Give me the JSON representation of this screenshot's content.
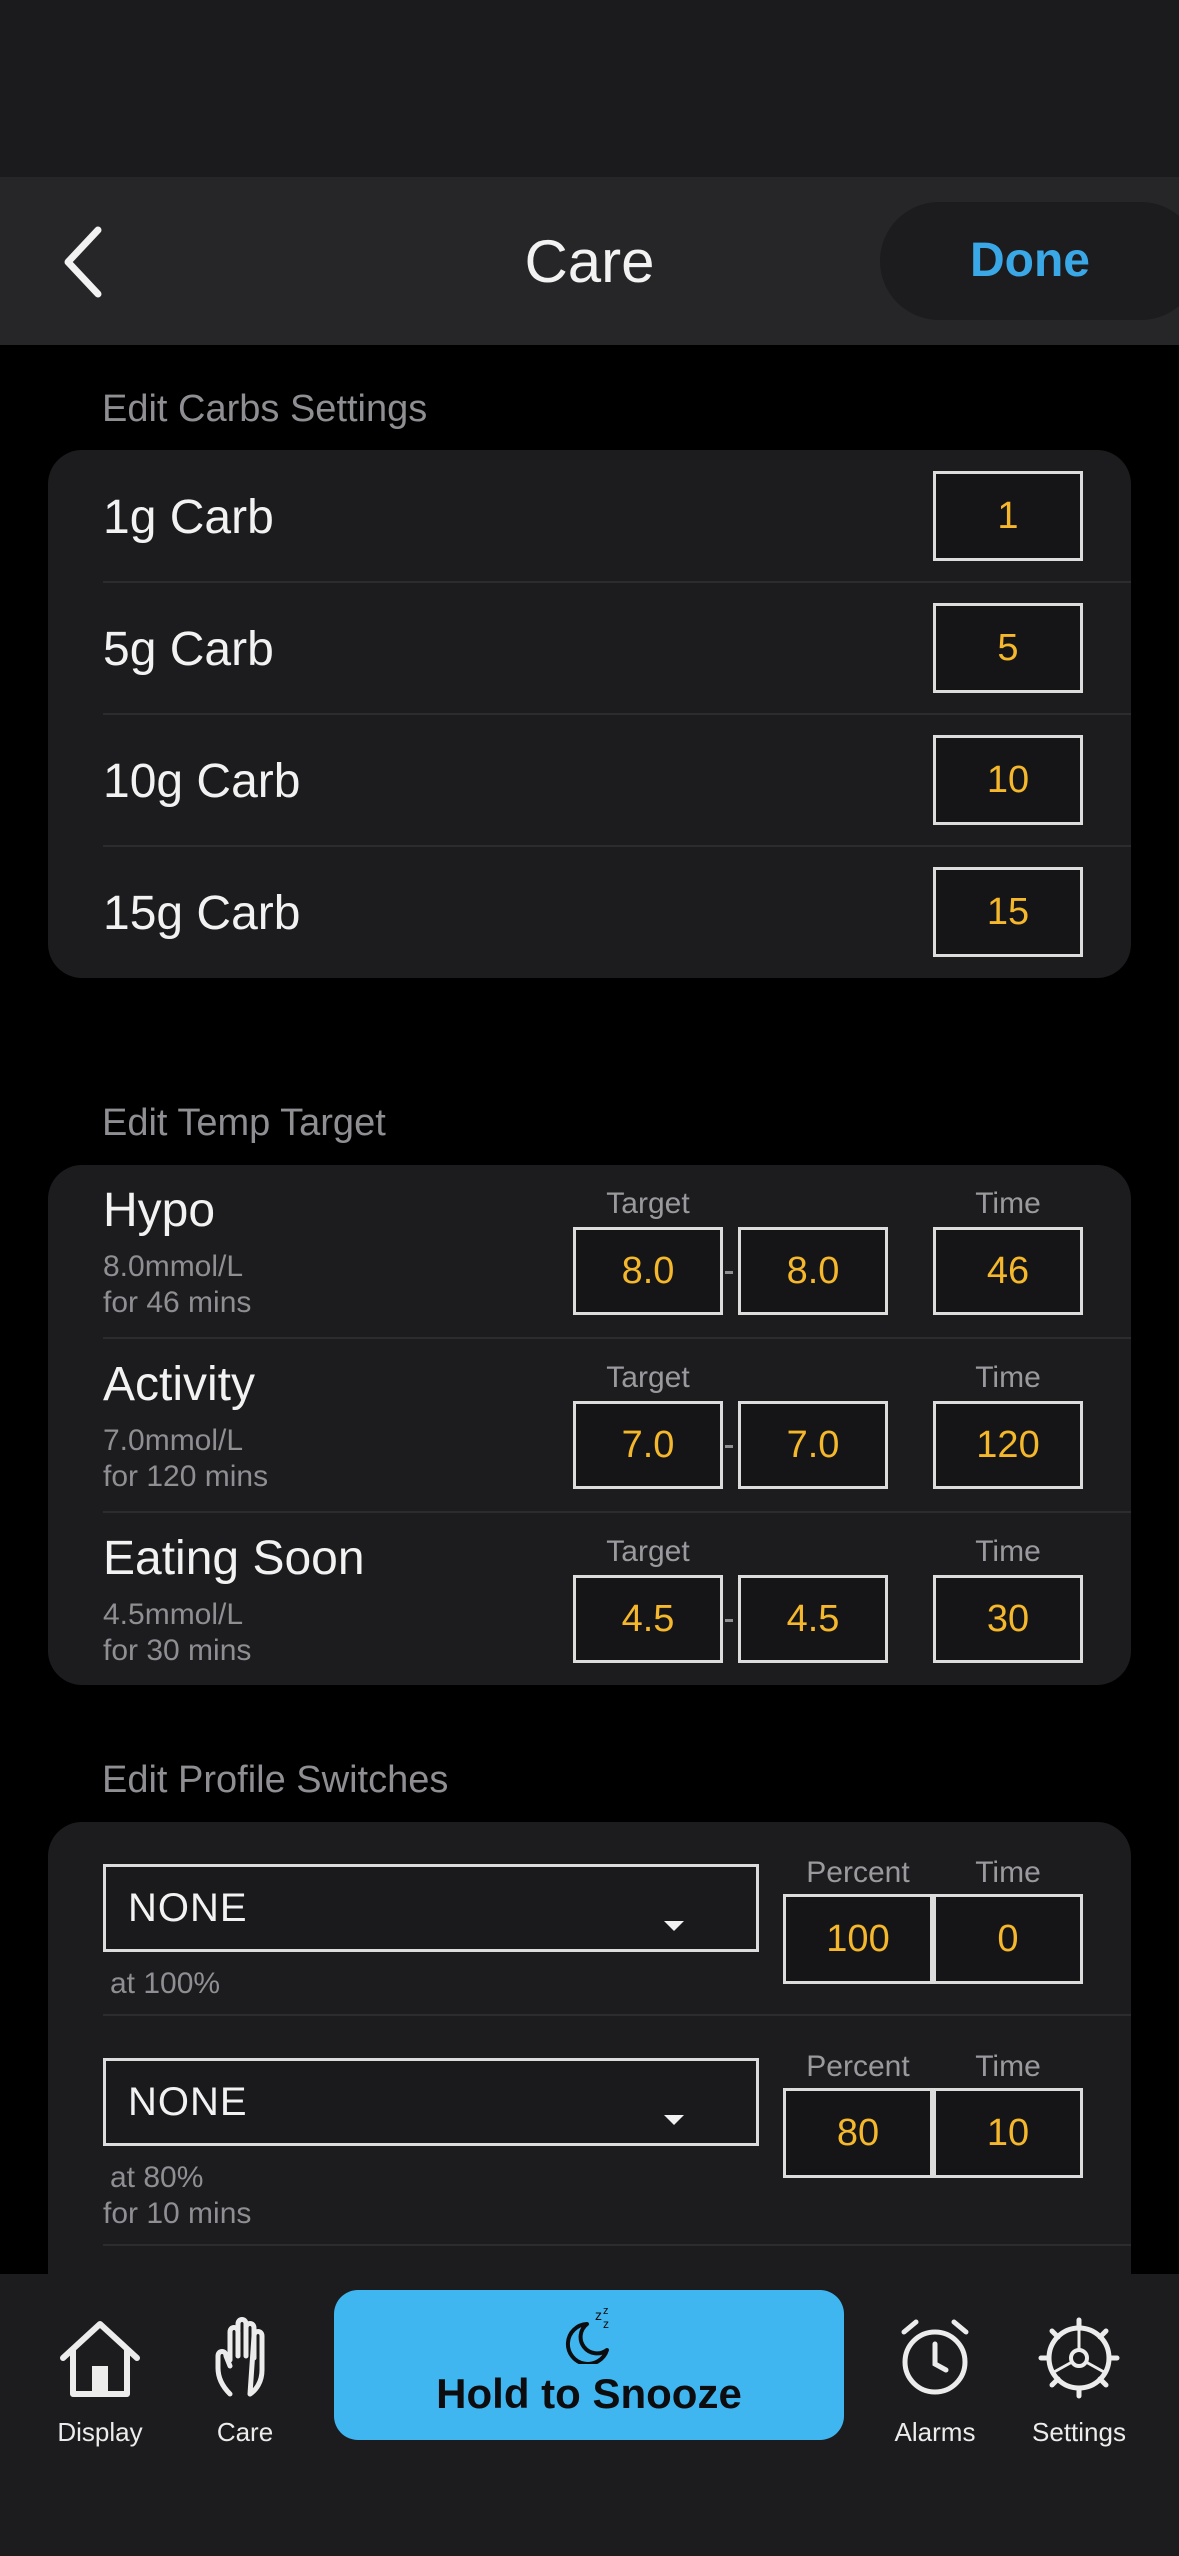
{
  "header": {
    "title": "Care",
    "done_label": "Done"
  },
  "carbs": {
    "section_title": "Edit Carbs Settings",
    "rows": [
      {
        "label": "1g Carb",
        "value": "1"
      },
      {
        "label": "5g Carb",
        "value": "5"
      },
      {
        "label": "10g Carb",
        "value": "10"
      },
      {
        "label": "15g Carb",
        "value": "15"
      }
    ]
  },
  "temp_target": {
    "section_title": "Edit Temp Target",
    "target_header": "Target",
    "time_header": "Time",
    "rows": [
      {
        "name": "Hypo",
        "sub1": "8.0mmol/L",
        "sub2": "for 46 mins",
        "low": "8.0",
        "high": "8.0",
        "time": "46"
      },
      {
        "name": "Activity",
        "sub1": "7.0mmol/L",
        "sub2": "for 120 mins",
        "low": "7.0",
        "high": "7.0",
        "time": "120"
      },
      {
        "name": "Eating Soon",
        "sub1": "4.5mmol/L",
        "sub2": "for 30 mins",
        "low": "4.5",
        "high": "4.5",
        "time": "30"
      }
    ]
  },
  "profile_switches": {
    "section_title": "Edit Profile Switches",
    "percent_header": "Percent",
    "time_header": "Time",
    "rows": [
      {
        "profile": "NONE",
        "sub1": "at 100%",
        "sub2": "",
        "percent": "100",
        "time": "0"
      },
      {
        "profile": "NONE",
        "sub1": "at 80%",
        "sub2": "for 10 mins",
        "percent": "80",
        "time": "10"
      }
    ]
  },
  "tabbar": {
    "display_label": "Display",
    "care_label": "Care",
    "snooze_label": "Hold to Snooze",
    "alarms_label": "Alarms",
    "settings_label": "Settings"
  },
  "colors": {
    "accent_blue": "#3aa8e6",
    "value_orange": "#f5b72b",
    "snooze_button": "#3fb6f0"
  }
}
